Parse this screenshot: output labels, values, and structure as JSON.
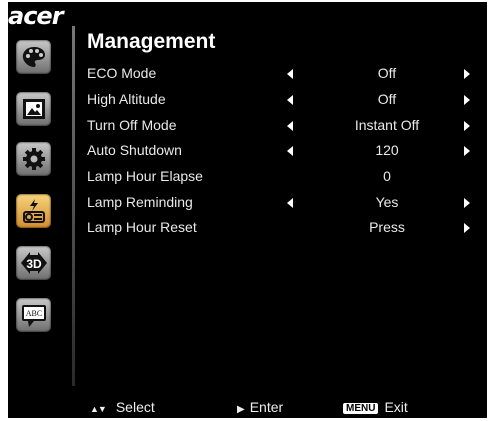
{
  "brand": "acer",
  "title": "Management",
  "sidebar": [
    {
      "icon": "palette-icon"
    },
    {
      "icon": "image-icon"
    },
    {
      "icon": "gear-icon"
    },
    {
      "icon": "projector-lamp-icon",
      "active": true
    },
    {
      "icon": "3d-icon"
    },
    {
      "icon": "language-icon",
      "text": "ABC"
    }
  ],
  "rows": [
    {
      "label": "ECO Mode",
      "value": "Off",
      "arrows": true
    },
    {
      "label": "High Altitude",
      "value": "Off",
      "arrows": true
    },
    {
      "label": "Turn Off Mode",
      "value": "Instant Off",
      "arrows": true
    },
    {
      "label": "Auto Shutdown",
      "value": "120",
      "arrows": true
    },
    {
      "label": "Lamp Hour Elapse",
      "value": "0",
      "arrows": false
    },
    {
      "label": "Lamp Reminding",
      "value": "Yes",
      "arrows": true
    },
    {
      "label": "Lamp Hour Reset",
      "value": "Press",
      "arrows": "right"
    }
  ],
  "footer": {
    "select_label": "Select",
    "enter_label": "Enter",
    "menu_key": "MENU",
    "exit_label": "Exit"
  },
  "colors": {
    "background": "#000000",
    "active_icon": "#e9a84a",
    "text": "#e9e9e9"
  }
}
